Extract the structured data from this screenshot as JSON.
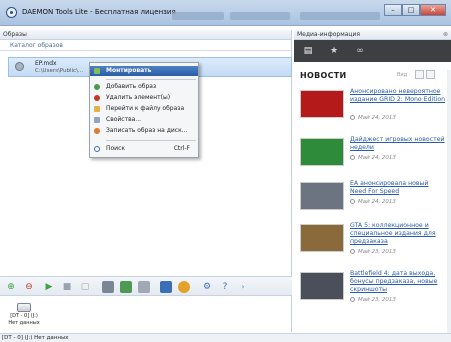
{
  "window": {
    "title": "DAEMON Tools Lite - Бесплатная лицензия"
  },
  "left_pane": {
    "header": "Образы",
    "catalog_label": "Каталог образов",
    "image": {
      "name": "EP.mdx",
      "path": "C:\\Users\\Public\\..."
    }
  },
  "context_menu": {
    "items": [
      {
        "label": "Монтировать",
        "icon": "mount-icon",
        "highlighted": true
      },
      {
        "label": "Добавить образ",
        "icon": "add-image-icon"
      },
      {
        "label": "Удалить элемент(ы)",
        "icon": "remove-icon"
      },
      {
        "label": "Перейти к файлу образа",
        "icon": "folder-icon"
      },
      {
        "label": "Свойства...",
        "icon": "properties-icon"
      },
      {
        "label": "Записать образ на диск...",
        "icon": "burn-icon"
      },
      {
        "label": "Поиск",
        "icon": "search-icon",
        "shortcut": "Ctrl-F"
      }
    ]
  },
  "drive": {
    "label_line1": "[DT - 0] (J:)",
    "label_line2": "Нет данных"
  },
  "statusbar": {
    "text": "[DT - 0] (J:) Нет данных"
  },
  "right_pane": {
    "header": "Медиа-информация",
    "news_title": "НОВОСТИ",
    "view_label": "Вид",
    "news": [
      {
        "text": "Анонсировано невероятное издание GRID 2: Mono Edition",
        "date": "Май 24, 2013",
        "thumb_color": "#b51a1a"
      },
      {
        "text": "Дайджест игровых новостей недели",
        "date": "Май 24, 2013",
        "thumb_color": "#2e8b3a"
      },
      {
        "text": "EA анонсировала новый Need For Speed",
        "date": "Май 24, 2013",
        "thumb_color": "#6b7480"
      },
      {
        "text": "GTA 5: коллекционное и специальное издания для предзаказа",
        "date": "Май 23, 2013",
        "thumb_color": "#8a6a3a"
      },
      {
        "text": "Battlefield 4: дата выхода, бонусы предзаказа, новые скриншоты",
        "date": "Май 23, 2013",
        "thumb_color": "#4a4f5a"
      }
    ]
  },
  "colors": {
    "accent": "#2c5ea7",
    "link": "#2a5da8"
  }
}
